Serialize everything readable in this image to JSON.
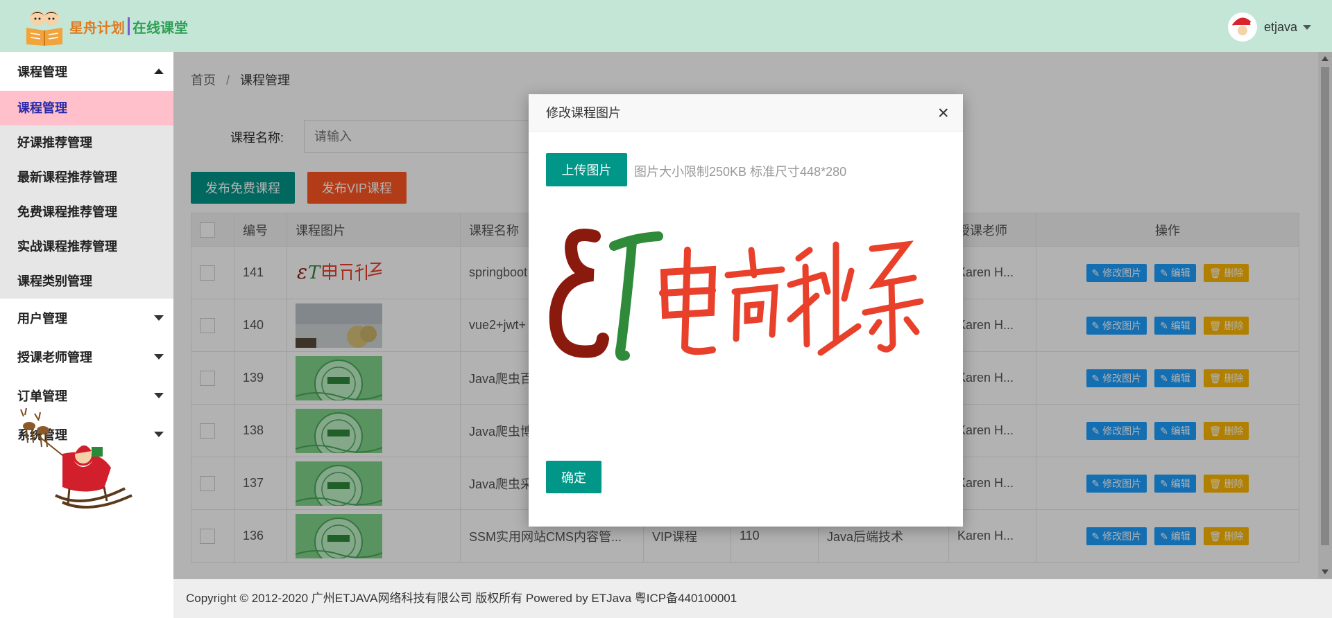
{
  "header": {
    "logo_main": "星舟计划",
    "logo_sub": "在线课堂",
    "user_name": "etjava"
  },
  "sidebar": {
    "groups": [
      {
        "label": "课程管理",
        "expanded": true,
        "items": [
          "课程管理",
          "好课推荐管理",
          "最新课程推荐管理",
          "免费课程推荐管理",
          "实战课程推荐管理",
          "课程类别管理"
        ],
        "active": "课程管理"
      },
      {
        "label": "用户管理",
        "expanded": false
      },
      {
        "label": "授课老师管理",
        "expanded": false
      },
      {
        "label": "订单管理",
        "expanded": false
      },
      {
        "label": "系统管理",
        "expanded": false
      }
    ]
  },
  "breadcrumb": {
    "home": "首页",
    "sep": "/",
    "current": "课程管理"
  },
  "search": {
    "label": "课程名称:",
    "placeholder": "请输入"
  },
  "toolbar": {
    "free_btn": "发布免费课程",
    "vip_btn": "发布VIP课程"
  },
  "table": {
    "columns": [
      "编号",
      "课程图片",
      "课程名称",
      "授课老师",
      "操作"
    ],
    "rows": [
      {
        "id": "141",
        "img": "et-logo",
        "name": "springboot",
        "type": "",
        "price": "",
        "category": "",
        "teacher": "Karen H..."
      },
      {
        "id": "140",
        "img": "photo",
        "name": "vue2+jwt+",
        "type": "",
        "price": "",
        "category": "",
        "teacher": "Karen H..."
      },
      {
        "id": "139",
        "img": "green-badge",
        "name": "Java爬虫百",
        "type": "",
        "price": "",
        "category": "",
        "teacher": "Karen H..."
      },
      {
        "id": "138",
        "img": "green-badge",
        "name": "Java爬虫博",
        "type": "",
        "price": "",
        "category": "",
        "teacher": "Karen H..."
      },
      {
        "id": "137",
        "img": "green-badge",
        "name": "Java爬虫采",
        "type": "",
        "price": "",
        "category": "",
        "teacher": "Karen H..."
      },
      {
        "id": "136",
        "img": "green-badge",
        "name": "SSM实用网站CMS内容管...",
        "type": "VIP课程",
        "price": "110",
        "category": "Java后端技术",
        "teacher": "Karen H..."
      }
    ],
    "ops": {
      "edit_img": "修改图片",
      "edit": "编辑",
      "delete": "删除"
    }
  },
  "footer": {
    "text": "Copyright © 2012-2020 广州ETJAVA网络科技有限公司 版权所有 Powered by ETJava 粤ICP备440100001"
  },
  "modal": {
    "title": "修改课程图片",
    "upload_btn": "上传图片",
    "tip": "图片大小限制250KB 标准尺寸448*280",
    "confirm_btn": "确定",
    "preview_logo": "ET电商秒杀"
  },
  "colors": {
    "header_bg": "#c3e6d6",
    "primary": "#009688",
    "vip_btn": "#ff5722",
    "op_blue": "#1e9fff",
    "op_yellow": "#ffb800",
    "active_menu": "#ffc0cb"
  }
}
